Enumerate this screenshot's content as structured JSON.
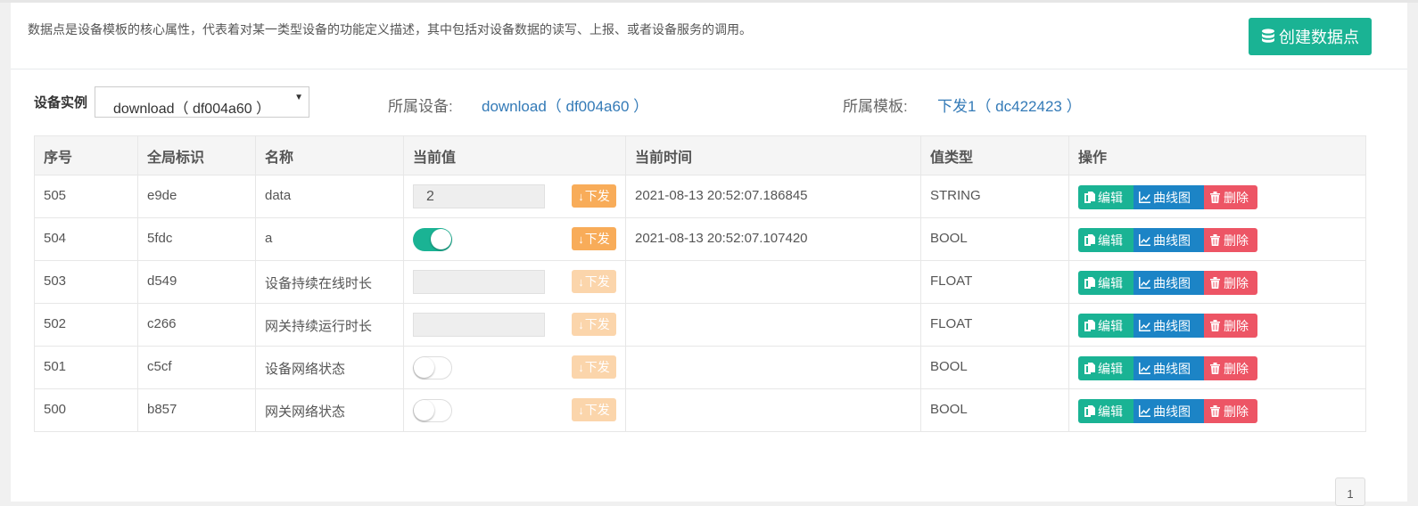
{
  "header": {
    "description": "数据点是设备模板的核心属性，代表着对某一类型设备的功能定义描述，其中包括对设备数据的读写、上报、或者设备服务的调用。",
    "create_button": "创建数据点"
  },
  "filter": {
    "label": "设备实例",
    "selected": "download（ df004a60 ）",
    "device_label": "所属设备:",
    "device_value": "download（ df004a60 ）",
    "template_label": "所属模板:",
    "template_value": "下发1（ dc422423 ）"
  },
  "table": {
    "headers": [
      "序号",
      "全局标识",
      "名称",
      "当前值",
      "当前时间",
      "值类型",
      "操作"
    ],
    "send_label": "下发",
    "ops": {
      "edit": "编辑",
      "chart": "曲线图",
      "delete": "删除"
    },
    "rows": [
      {
        "id": "505",
        "key": "e9de",
        "name": "data",
        "value_kind": "input",
        "value": "2",
        "time": "2021-08-13 20:52:07.186845",
        "type": "STRING",
        "send_enabled": true
      },
      {
        "id": "504",
        "key": "5fdc",
        "name": "a",
        "value_kind": "toggle",
        "on": true,
        "time": "2021-08-13 20:52:07.107420",
        "type": "BOOL",
        "send_enabled": true
      },
      {
        "id": "503",
        "key": "d549",
        "name": "设备持续在线时长",
        "value_kind": "input",
        "value": "",
        "time": "",
        "type": "FLOAT",
        "send_enabled": false
      },
      {
        "id": "502",
        "key": "c266",
        "name": "网关持续运行时长",
        "value_kind": "input",
        "value": "",
        "time": "",
        "type": "FLOAT",
        "send_enabled": false
      },
      {
        "id": "501",
        "key": "c5cf",
        "name": "设备网络状态",
        "value_kind": "toggle",
        "on": false,
        "time": "",
        "type": "BOOL",
        "send_enabled": false
      },
      {
        "id": "500",
        "key": "b857",
        "name": "网关网络状态",
        "value_kind": "toggle",
        "on": false,
        "time": "",
        "type": "BOOL",
        "send_enabled": false
      }
    ]
  },
  "pagination": {
    "current_page": "1"
  },
  "colors": {
    "primary": "#1ab394",
    "info": "#1c84c6",
    "danger": "#ed5565",
    "warning": "#f8ac59",
    "link": "#337ab7"
  }
}
